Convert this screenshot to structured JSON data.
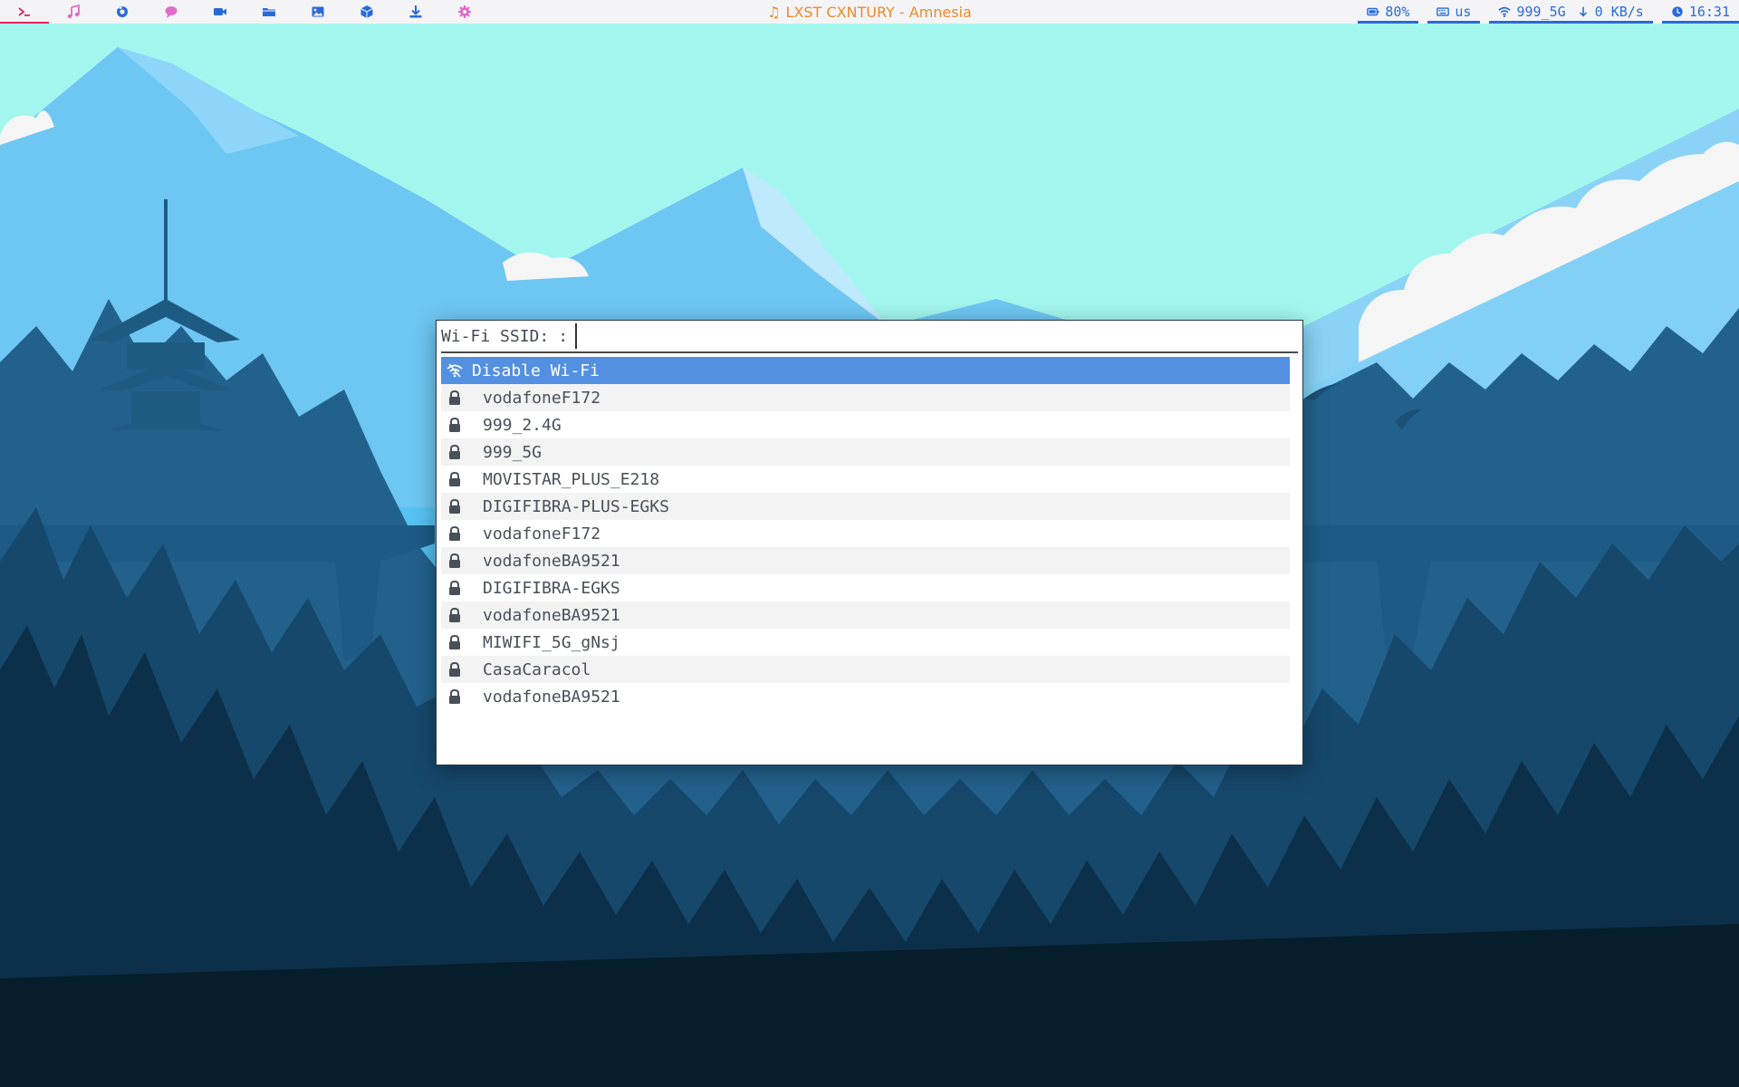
{
  "topbar": {
    "workspaces": [
      {
        "icon": "terminal-icon",
        "color": "#e0245e",
        "active": true
      },
      {
        "icon": "music-icon",
        "color": "#e06cc8"
      },
      {
        "icon": "browser-icon",
        "color": "#2a6ad8"
      },
      {
        "icon": "chat-icon",
        "color": "#e06cc8"
      },
      {
        "icon": "video-icon",
        "color": "#2a6ad8"
      },
      {
        "icon": "folder-icon",
        "color": "#2a6ad8"
      },
      {
        "icon": "image-icon",
        "color": "#2a6ad8"
      },
      {
        "icon": "package-icon",
        "color": "#2a6ad8"
      },
      {
        "icon": "download-icon",
        "color": "#2a6ad8"
      },
      {
        "icon": "settings-icon",
        "color": "#e06cc8"
      }
    ],
    "now_playing": "LXST CXNTURY - Amnesia",
    "battery": "80%",
    "keyboard_layout": "us",
    "wifi_ssid": "999_5G",
    "net_speed": "0 KB/s",
    "clock": "16:31",
    "accent": "#2a6ad8",
    "title_color": "#ea8a2c"
  },
  "menu": {
    "prompt": "Wi-Fi SSID:",
    "separator": ":",
    "input_value": "",
    "items": [
      {
        "label": "Disable Wi-Fi",
        "icon": "wifi-off-icon",
        "selected": true
      },
      {
        "label": "vodafoneF172",
        "icon": "lock-icon"
      },
      {
        "label": "999_2.4G",
        "icon": "lock-icon"
      },
      {
        "label": "999_5G",
        "icon": "lock-icon"
      },
      {
        "label": "MOVISTAR_PLUS_E218",
        "icon": "lock-icon"
      },
      {
        "label": "DIGIFIBRA-PLUS-EGKS",
        "icon": "lock-icon"
      },
      {
        "label": "vodafoneF172",
        "icon": "lock-icon"
      },
      {
        "label": "vodafoneBA9521",
        "icon": "lock-icon"
      },
      {
        "label": "DIGIFIBRA-EGKS",
        "icon": "lock-icon"
      },
      {
        "label": "vodafoneBA9521",
        "icon": "lock-icon"
      },
      {
        "label": "MIWIFI_5G_gNsj",
        "icon": "lock-icon"
      },
      {
        "label": "CasaCaracol",
        "icon": "lock-icon"
      },
      {
        "label": "vodafoneBA9521",
        "icon": "lock-icon"
      }
    ],
    "selected_color": "#5490e2"
  }
}
